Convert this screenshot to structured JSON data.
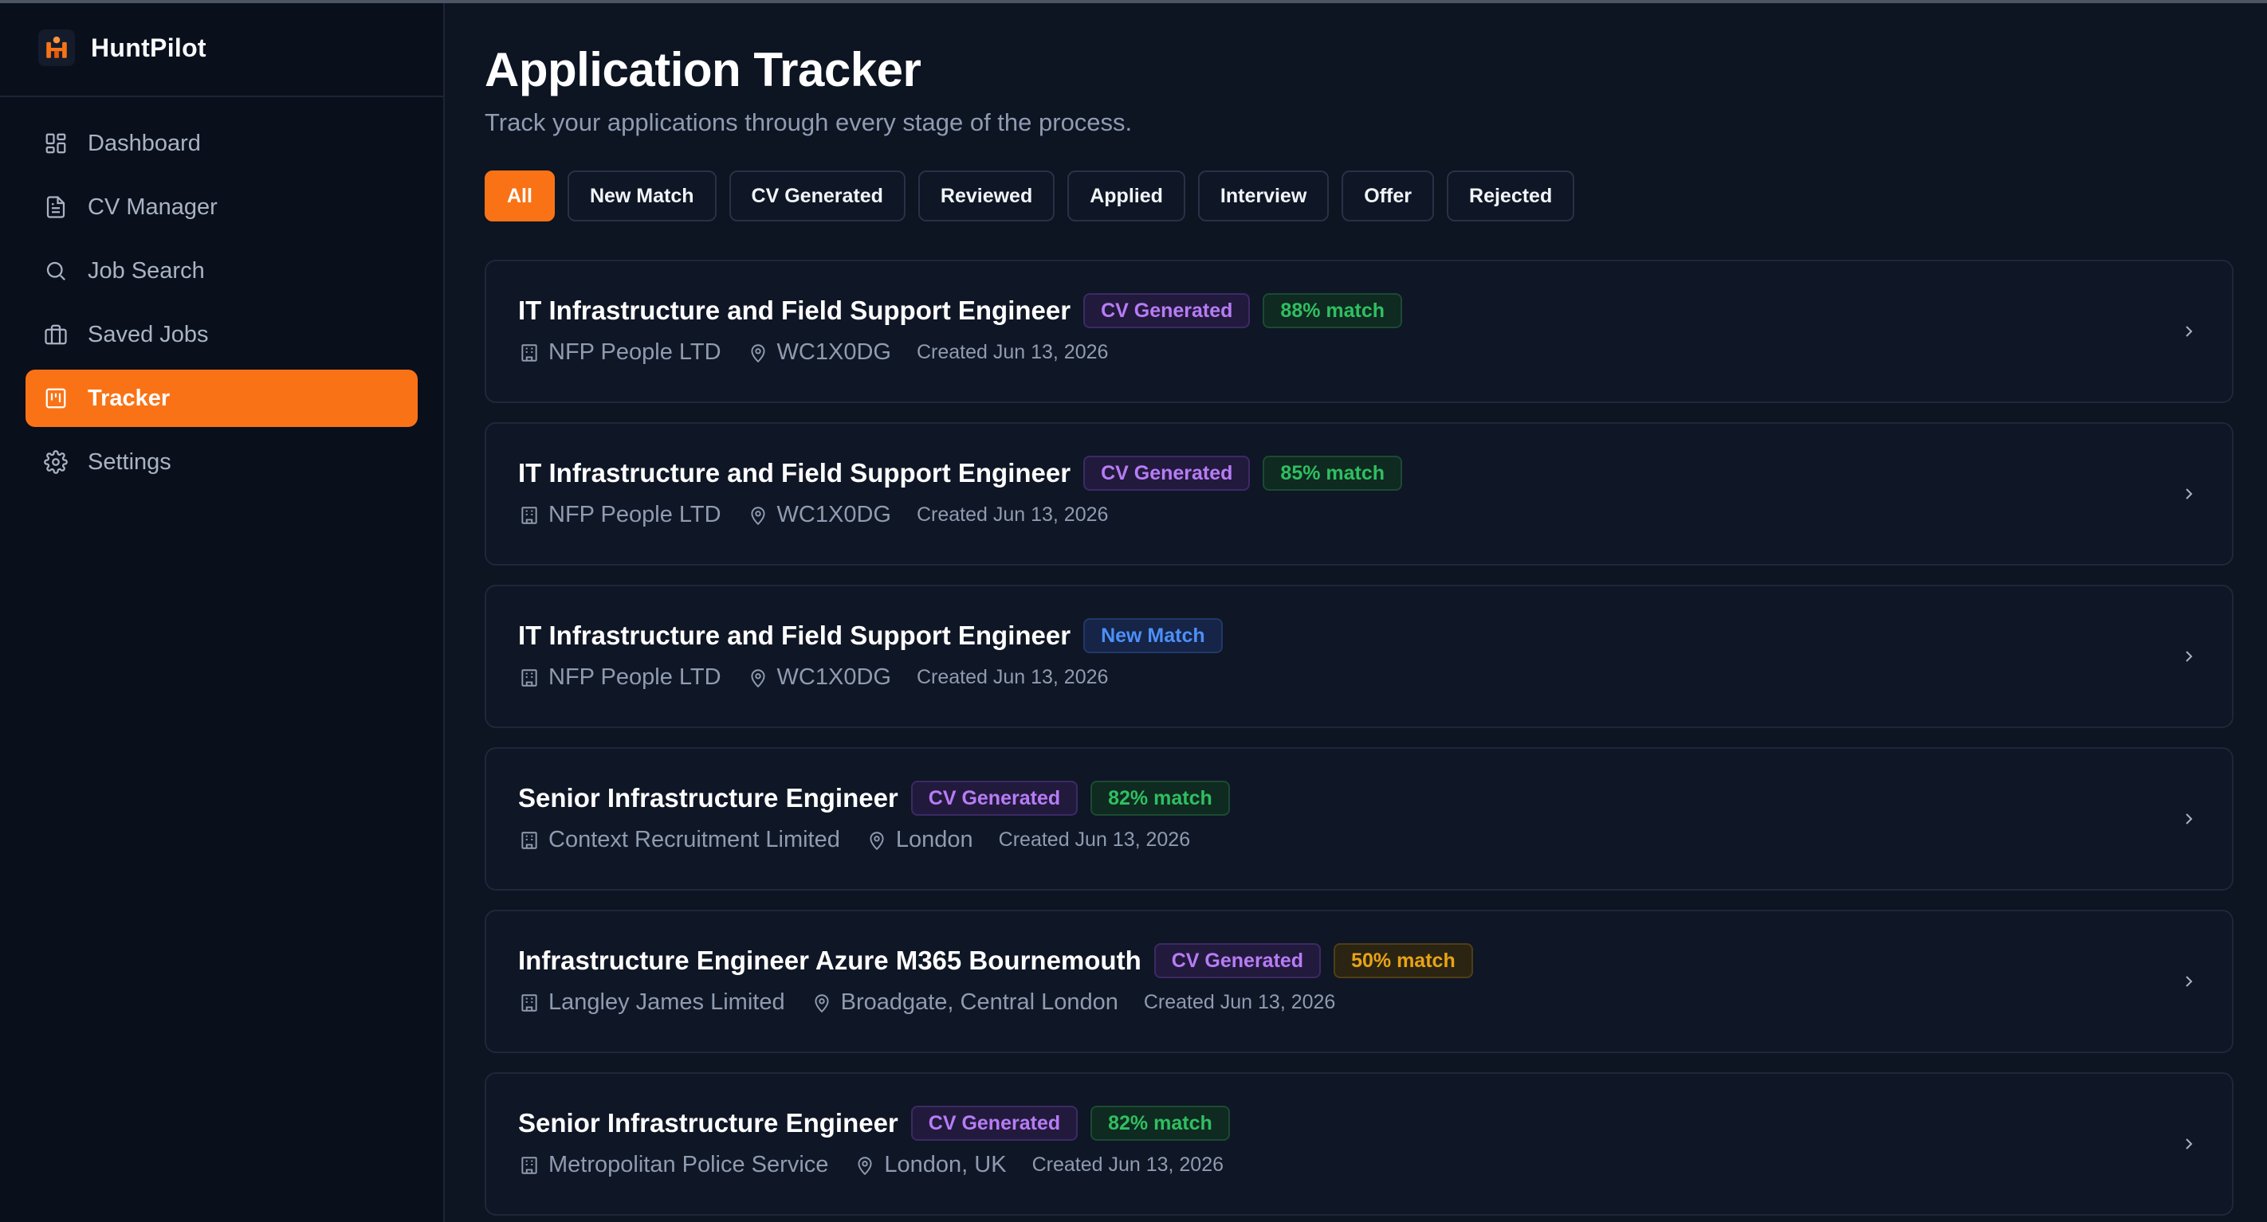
{
  "app": {
    "name": "HuntPilot"
  },
  "sidebar": {
    "items": [
      {
        "label": "Dashboard",
        "icon": "dashboard-icon"
      },
      {
        "label": "CV Manager",
        "icon": "document-icon"
      },
      {
        "label": "Job Search",
        "icon": "search-icon"
      },
      {
        "label": "Saved Jobs",
        "icon": "briefcase-icon"
      },
      {
        "label": "Tracker",
        "icon": "tracker-icon",
        "active": true
      },
      {
        "label": "Settings",
        "icon": "gear-icon"
      }
    ]
  },
  "page": {
    "title": "Application Tracker",
    "subtitle": "Track your applications through every stage of the process."
  },
  "filters": [
    "All",
    "New Match",
    "CV Generated",
    "Reviewed",
    "Applied",
    "Interview",
    "Offer",
    "Rejected"
  ],
  "active_filter": "All",
  "applications": [
    {
      "title": "IT Infrastructure and Field Support Engineer",
      "status": "CV Generated",
      "match": "88% match",
      "company": "NFP People LTD",
      "location": "WC1X0DG",
      "created": "Created Jun 13, 2026"
    },
    {
      "title": "IT Infrastructure and Field Support Engineer",
      "status": "CV Generated",
      "match": "85% match",
      "company": "NFP People LTD",
      "location": "WC1X0DG",
      "created": "Created Jun 13, 2026"
    },
    {
      "title": "IT Infrastructure and Field Support Engineer",
      "status": "New Match",
      "company": "NFP People LTD",
      "location": "WC1X0DG",
      "created": "Created Jun 13, 2026"
    },
    {
      "title": "Senior Infrastructure Engineer",
      "status": "CV Generated",
      "match": "82% match",
      "company": "Context Recruitment Limited",
      "location": "London",
      "created": "Created Jun 13, 2026"
    },
    {
      "title": "Infrastructure Engineer Azure M365 Bournemouth",
      "status": "CV Generated",
      "match": "50% match",
      "company": "Langley James Limited",
      "location": "Broadgate, Central London",
      "created": "Created Jun 13, 2026"
    },
    {
      "title": "Senior Infrastructure Engineer",
      "status": "CV Generated",
      "match": "82% match",
      "company": "Metropolitan Police Service",
      "location": "London, UK",
      "created": "Created Jun 13, 2026"
    }
  ],
  "colors": {
    "accent": "#f97316",
    "background": "#0d1422",
    "sidebar": "#0a0f1c",
    "status_cv_generated": "#b77cf5",
    "status_new_match": "#4d8ff8",
    "match_high": "#2fbf61",
    "match_mid": "#e8a317"
  }
}
